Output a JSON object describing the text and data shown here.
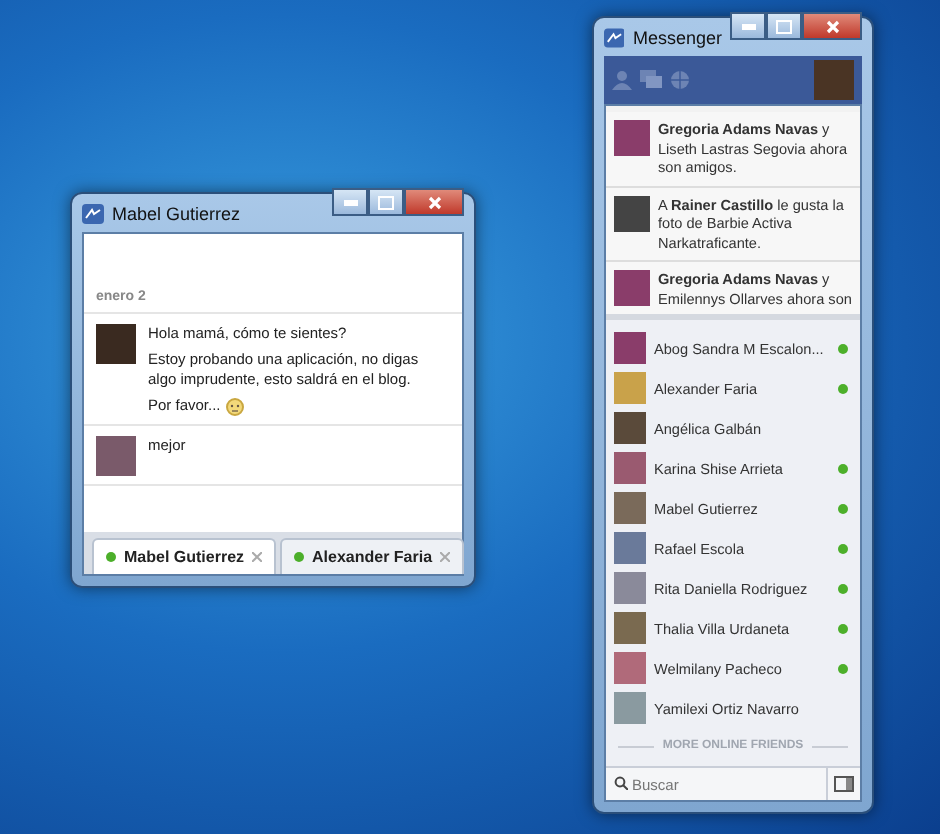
{
  "chat_window": {
    "title": "Mabel Gutierrez",
    "date": "enero 2",
    "messages": [
      {
        "lines": [
          "Hola mamá, cómo te sientes?",
          "Estoy probando una aplicación, no digas algo imprudente, esto saldrá en el blog.",
          "Por favor..."
        ],
        "emoticon": true
      },
      {
        "lines": [
          "mejor"
        ],
        "emoticon": false
      }
    ],
    "tabs": [
      {
        "label": "Mabel Gutierrez",
        "selected": true,
        "online": true
      },
      {
        "label": "Alexander Faria",
        "selected": false,
        "online": true
      }
    ]
  },
  "messenger_window": {
    "title": "Messenger",
    "feed": [
      {
        "text": "**Gregoria Adams Navas** y Liseth Lastras Segovia ahora son amigos."
      },
      {
        "text": "A **Rainer Castillo** le gusta la foto de Barbie Activa Narkatraficante."
      },
      {
        "text": "**Gregoria Adams Navas** y Emilennys Ollarves ahora son"
      }
    ],
    "friends": [
      {
        "name": "Abog Sandra M Escalon...",
        "online": true
      },
      {
        "name": "Alexander Faria",
        "online": true
      },
      {
        "name": "Angélica Galbán",
        "online": false
      },
      {
        "name": "Karina Shise Arrieta",
        "online": true
      },
      {
        "name": "Mabel Gutierrez",
        "online": true
      },
      {
        "name": "Rafael Escola",
        "online": true
      },
      {
        "name": "Rita Daniella Rodriguez",
        "online": true
      },
      {
        "name": "Thalia Villa Urdaneta",
        "online": true
      },
      {
        "name": "Welmilany Pacheco",
        "online": true
      },
      {
        "name": "Yamilexi Ortiz Navarro",
        "online": false
      }
    ],
    "more_label": "MORE ONLINE FRIENDS",
    "search": {
      "placeholder": "Buscar"
    }
  }
}
